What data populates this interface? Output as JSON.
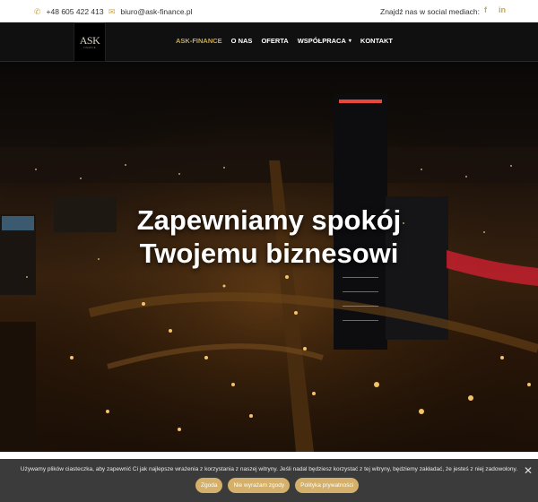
{
  "topbar": {
    "phone": "+48 605 422 413",
    "email": "biuro@ask-finance.pl",
    "social_label": "Znajdź nas w social mediach:",
    "phone_icon": "phone-icon",
    "email_icon": "envelope-icon",
    "facebook": "f",
    "linkedin": "in"
  },
  "logo": {
    "mark": "ASK",
    "sub": "FINANCE"
  },
  "nav": {
    "items": [
      {
        "label": "ASK-FINANCE",
        "active": true
      },
      {
        "label": "O NAS"
      },
      {
        "label": "OFERTA"
      },
      {
        "label": "WSPÓŁPRACA",
        "has_dropdown": true
      },
      {
        "label": "KONTAKT"
      }
    ]
  },
  "hero": {
    "title_line1": "Zapewniamy spokój",
    "title_line2": "Twojemu biznesowi"
  },
  "cookie": {
    "message": "Używamy plików ciasteczka, aby zapewnić Ci jak najlepsze wrażenia z korzystania z naszej witryny. Jeśli nadal będziesz korzystać z tej witryny, będziemy zakładać, że jesteś z niej zadowolony.",
    "accept": "Zgoda",
    "decline": "Nie wyrażam zgody",
    "privacy": "Polityka prywatności",
    "close": "✕"
  },
  "colors": {
    "accent": "#c9a94b",
    "cookie_button": "#d4b06a",
    "navbar": "#101010",
    "cookie_bg": "#3b3b3b"
  }
}
